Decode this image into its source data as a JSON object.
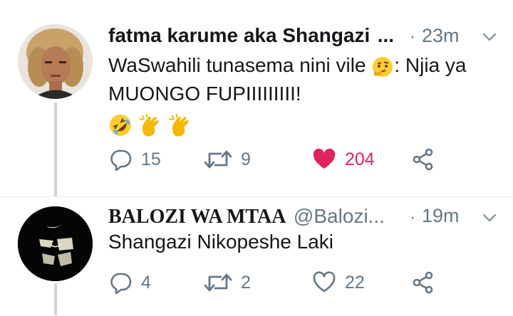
{
  "tweets": [
    {
      "display_name": "fatma karume aka Shangazi",
      "ellipsis": "...",
      "separator": "·",
      "time": "23m",
      "text_line1": "WaSwahili tunasema nini vile",
      "text_line1_after": ": Njia ya",
      "text_line2": "MUONGO FUPIIIIIIIII!",
      "emojis": [
        "rolling-on-floor-laughing",
        "clapping-hands",
        "clapping-hands"
      ],
      "replies": "15",
      "retweets": "9",
      "likes": "204",
      "liked": true
    },
    {
      "display_name": "BALOZI WA MTAA",
      "handle": "@Balozi...",
      "separator": "·",
      "time": "19m",
      "text": "Shangazi Nikopeshe Laki",
      "replies": "4",
      "retweets": "2",
      "likes": "22",
      "liked": false
    }
  ],
  "colors": {
    "like_active": "#e0245e",
    "muted": "#657786",
    "thread_line": "#ccd6dd"
  }
}
